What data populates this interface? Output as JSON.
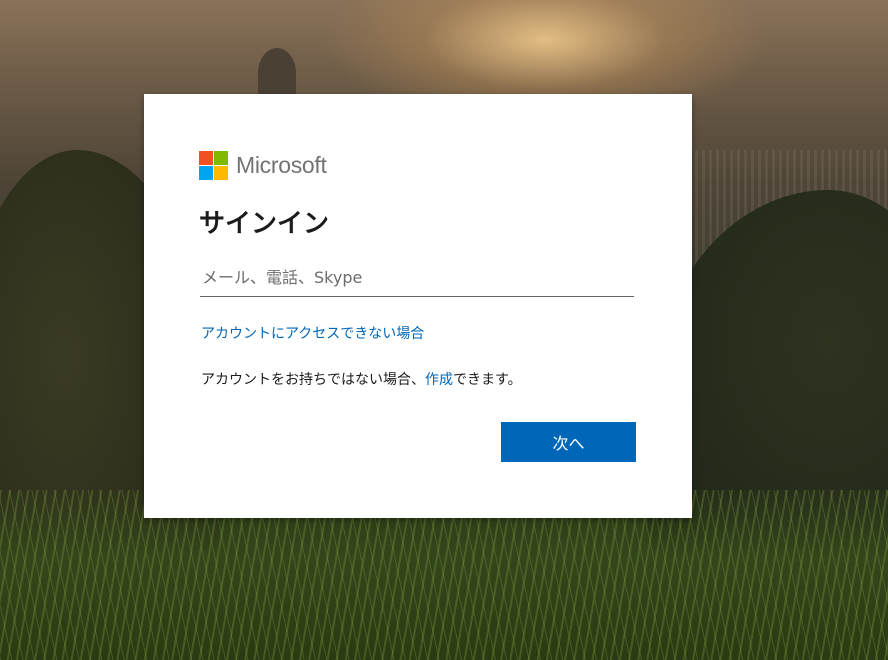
{
  "brand": {
    "name": "Microsoft",
    "logo_colors": [
      "#f25022",
      "#7fba00",
      "#00a4ef",
      "#ffb900"
    ],
    "text_color": "#737373"
  },
  "signin": {
    "title": "サインイン",
    "email_placeholder": "メール、電話、Skype",
    "email_value": "",
    "cant_access_link": "アカウントにアクセスできない場合",
    "no_account_prefix": "アカウントをお持ちではない場合、",
    "create_link": "作成",
    "no_account_suffix": "できます。",
    "next_button": "次へ"
  },
  "colors": {
    "accent": "#0067b8",
    "card_bg": "#ffffff",
    "text": "#1b1b1b"
  }
}
